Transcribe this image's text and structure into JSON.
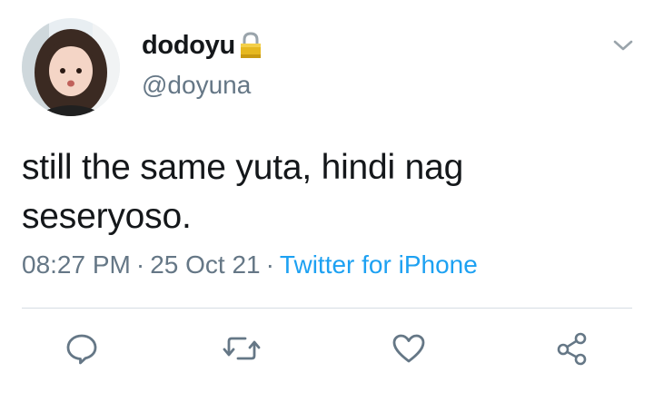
{
  "tweet": {
    "display_name": "dodoyu",
    "handle": "@doyuna",
    "text": "still the same yuta, hindi nag seseryoso.",
    "time": "08:27 PM",
    "separator": "·",
    "date": "25 Oct 21",
    "source": "Twitter for iPhone",
    "protected": true
  },
  "icons": {
    "lock": "lock-icon",
    "caret": "chevron-down-icon",
    "reply": "reply-icon",
    "retweet": "retweet-icon",
    "like": "heart-icon",
    "share": "share-icon"
  },
  "colors": {
    "text": "#14171a",
    "secondary": "#657786",
    "link": "#1da1f2",
    "divider": "#d6dde3",
    "lock": "#f0c020"
  }
}
